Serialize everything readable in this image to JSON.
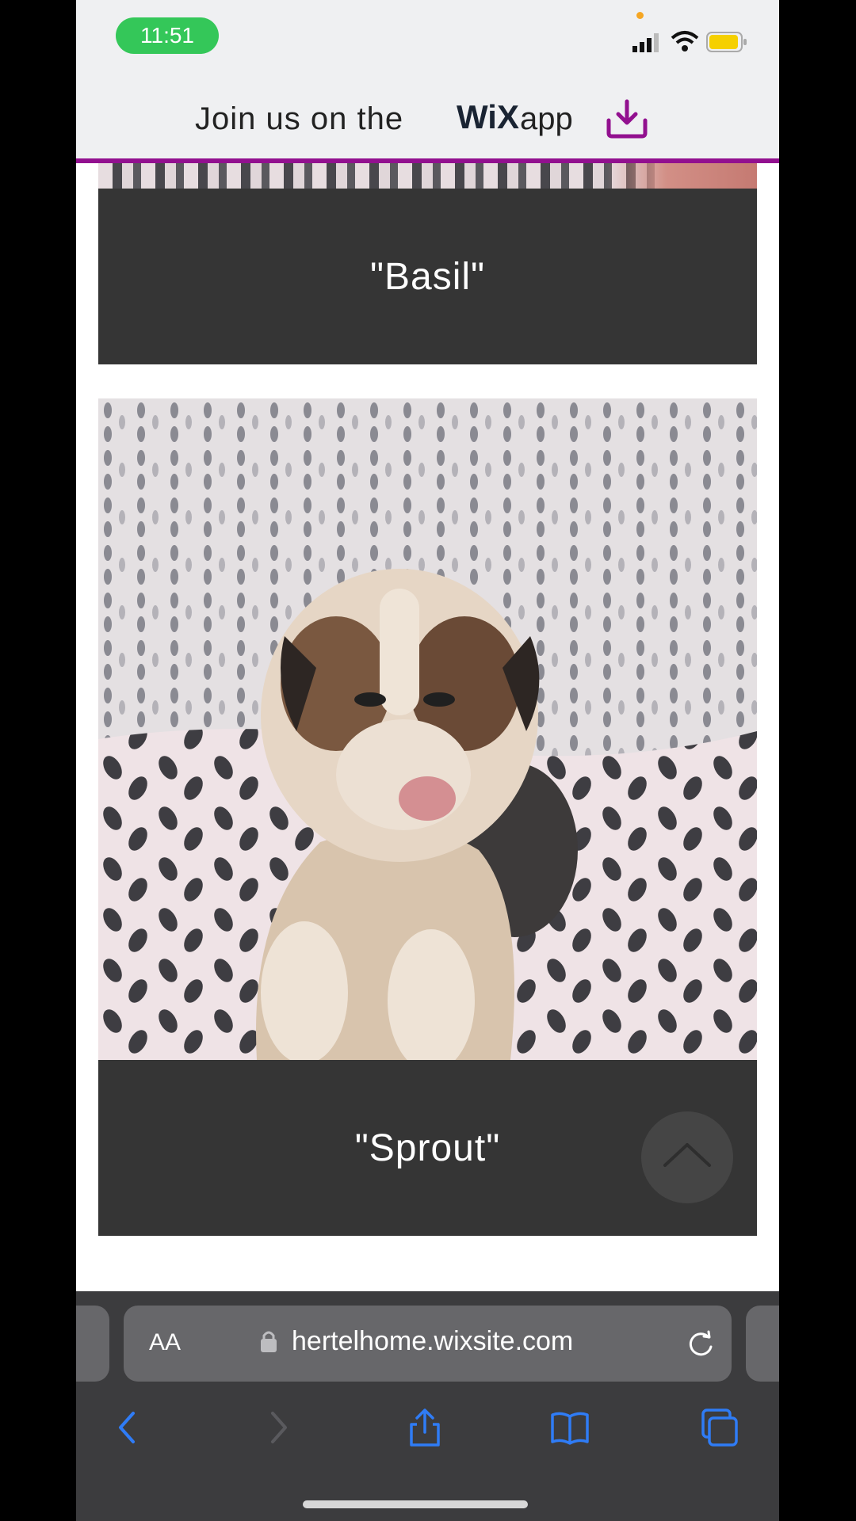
{
  "status_bar": {
    "time": "11:51"
  },
  "banner": {
    "text": "Join us on the",
    "brand": "WiX",
    "suffix": "app"
  },
  "puppies": [
    {
      "name": "\"Basil\""
    },
    {
      "name": "\"Sprout\""
    }
  ],
  "browser": {
    "text_size_label": "AA",
    "url": "hertelhome.wixsite.com"
  },
  "colors": {
    "banner_accent": "#92108f",
    "caption_bg": "#353535",
    "time_pill": "#34c759"
  }
}
